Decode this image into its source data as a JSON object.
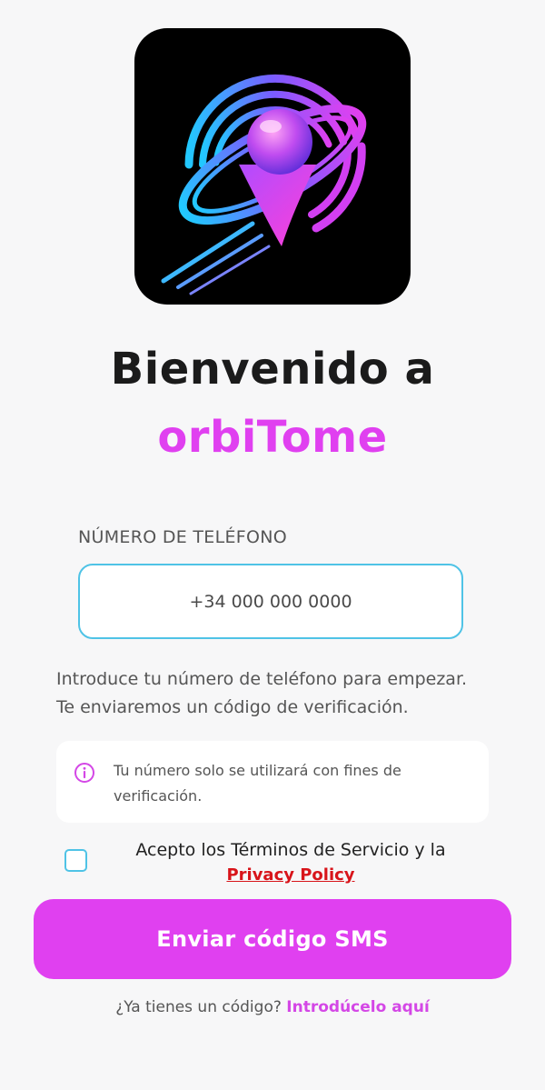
{
  "app": {
    "logo_icon": "orbit-location-pin-icon",
    "welcome_title": "Bienvenido a",
    "brand_name": "orbiTome",
    "brand_color": "#e040f0"
  },
  "phone": {
    "label": "NÚMERO DE TELÉFONO",
    "placeholder": "+34 000 000 0000",
    "value": "",
    "border_color": "#4fc3e6"
  },
  "helper": {
    "line1": "Introduce tu número de teléfono para empezar.",
    "line2": "Te enviaremos un código de verificación."
  },
  "info": {
    "icon": "info-circle-icon",
    "text": "Tu número solo se utilizará con fines de verificación."
  },
  "terms": {
    "checked": false,
    "text": "Acepto los Términos de Servicio y la",
    "privacy_link": "Privacy Policy",
    "privacy_color": "#d8141a"
  },
  "actions": {
    "send_label": "Enviar código SMS"
  },
  "footer": {
    "question": "¿Ya tienes un código?",
    "link": "Introdúcelo aquí"
  }
}
